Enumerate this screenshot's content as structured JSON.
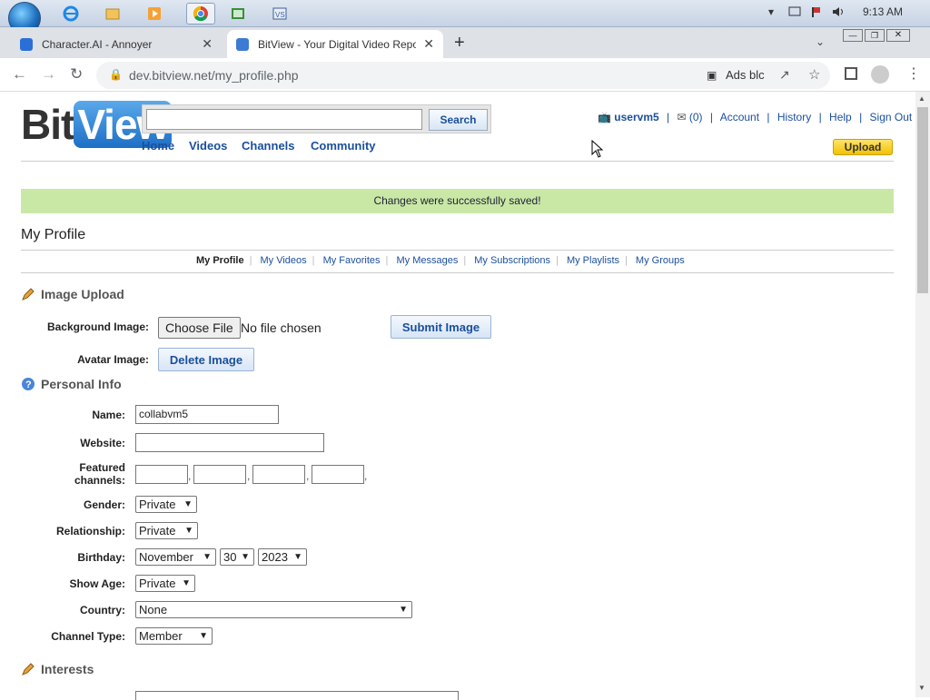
{
  "taskbar": {
    "start_icon": "windows-orb-icon",
    "pinned": [
      "ie-icon",
      "explorer-icon",
      "media-player-icon",
      "chrome-icon",
      "app-icon",
      "vs-icon"
    ],
    "clock": "9:13 AM"
  },
  "browser": {
    "tabs": [
      {
        "title": "Character.AI - Annoyer",
        "active": false,
        "favicon_color": "#2a6fd6"
      },
      {
        "title": "BitView - Your Digital Video Repository",
        "active": true,
        "favicon_color": "#3b7bd4"
      }
    ],
    "new_tab_label": "+",
    "url": "dev.bitview.net/my_profile.php",
    "adblock_label": "Ads blc"
  },
  "site": {
    "logo_a": "Bit",
    "logo_b": "View",
    "search_button": "Search",
    "nav": [
      "Home",
      "Videos",
      "Channels",
      "Community"
    ],
    "user": {
      "username": "uservm5",
      "inbox_count": "(0)",
      "links": [
        "Account",
        "History",
        "Help",
        "Sign Out"
      ]
    },
    "upload_label": "Upload"
  },
  "alert": "Changes were successfully saved!",
  "page_title": "My Profile",
  "subnav": {
    "items": [
      "My Profile",
      "My Videos",
      "My Favorites",
      "My Messages",
      "My Subscriptions",
      "My Playlists",
      "My Groups"
    ],
    "current": "My Profile"
  },
  "image_upload": {
    "heading": "Image Upload",
    "bg_label": "Background Image:",
    "choose_file": "Choose File",
    "no_file": "No file chosen",
    "submit_image": "Submit Image",
    "avatar_label": "Avatar Image:",
    "delete_image": "Delete Image"
  },
  "personal": {
    "heading": "Personal Info",
    "name_label": "Name:",
    "name_value": "collabvm5",
    "website_label": "Website:",
    "website_value": "",
    "featured_label_1": "Featured",
    "featured_label_2": "channels:",
    "gender_label": "Gender:",
    "gender_value": "Private",
    "relationship_label": "Relationship:",
    "relationship_value": "Private",
    "birthday_label": "Birthday:",
    "birth_month": "November",
    "birth_day": "30",
    "birth_year": "2023",
    "showage_label": "Show Age:",
    "showage_value": "Private",
    "country_label": "Country:",
    "country_value": "None",
    "channeltype_label": "Channel Type:",
    "channeltype_value": "Member"
  },
  "interests": {
    "heading": "Interests"
  }
}
